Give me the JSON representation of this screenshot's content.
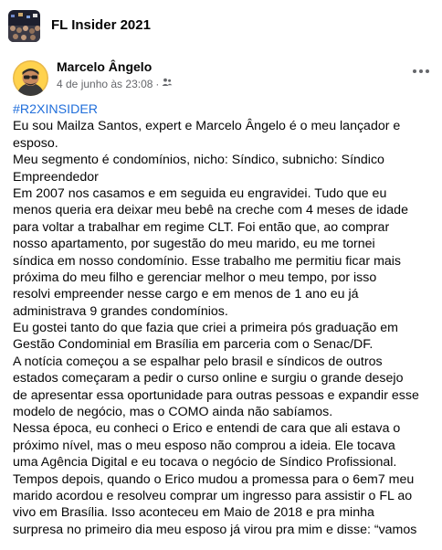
{
  "group": {
    "name": "FL Insider 2021"
  },
  "post": {
    "author": "Marcelo Ângelo",
    "timestamp": "4 de junho às 23:08",
    "separator": "·",
    "privacy_icon": "group-privacy-icon",
    "hashtag": "#R2XINSIDER",
    "lines": [
      "Eu sou Mailza Santos, expert e Marcelo Ângelo é o meu lançador e",
      "esposo.",
      "Meu segmento é condomínios, nicho: Síndico, subnicho: Síndico",
      "Empreendedor",
      "Em 2007 nos casamos e em seguida eu engravidei. Tudo que eu",
      "menos queria era deixar meu bebê na creche com 4 meses de idade",
      "para voltar a trabalhar em regime CLT. Foi então que, ao comprar",
      "nosso apartamento, por sugestão do meu marido, eu me tornei",
      "síndica em nosso condomínio.  Esse trabalho me permitiu ficar mais",
      "próxima do meu filho e gerenciar melhor o meu tempo, por isso",
      "resolvi empreender nesse cargo e em menos de 1 ano eu já",
      "administrava 9 grandes condomínios.",
      "Eu gostei tanto do que fazia que criei a primeira pós graduação em",
      "Gestão Condominial em Brasília em parceria com o Senac/DF.",
      "A notícia começou a se espalhar pelo brasil e síndicos de outros",
      "estados começaram a pedir o curso online e surgiu o grande desejo",
      "de apresentar essa oportunidade para outras pessoas e expandir esse",
      "modelo de negócio, mas o COMO ainda não sabíamos.",
      "Nessa época, eu conheci o Erico e entendi de cara que ali estava o",
      "próximo nível, mas o meu esposo não comprou a ideia. Ele tocava",
      "uma Agência Digital e eu tocava o negócio de Síndico Profissional.",
      "Tempos depois, quando o Erico mudou a promessa para o 6em7 meu",
      "marido acordou e resolveu comprar um ingresso para assistir o FL ao",
      "vivo em Brasília. Isso aconteceu em Maio de 2018 e pra minha",
      "surpresa no primeiro dia meu esposo já virou pra mim e disse: “vamos"
    ]
  },
  "colors": {
    "link": "#216fdb",
    "meta": "#65676b",
    "text": "#050505",
    "background": "#f0f2f5"
  }
}
